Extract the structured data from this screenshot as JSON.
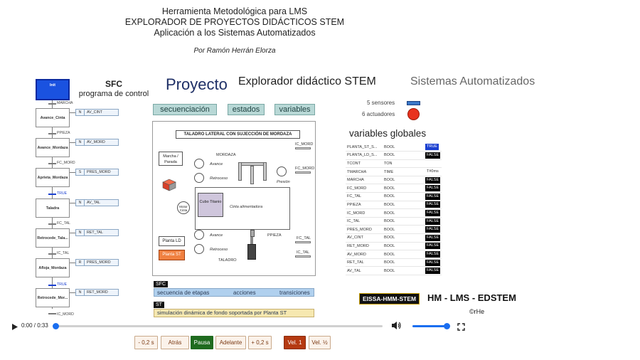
{
  "header": {
    "line1": "Herramienta Metodológica para LMS",
    "line2": "EXPLORADOR DE PROYECTOS DIDÁCTICOS STEM",
    "line3": "Aplicación a los Sistemas Automatizados",
    "author": "Por Ramón Herrán Elorza"
  },
  "sfc": {
    "title": "SFC",
    "subtitle": "programa de control",
    "steps": [
      {
        "name": "Init"
      },
      {
        "name": "Avance_Cinta",
        "qualifier": "N",
        "action": "AV_CINT"
      },
      {
        "name": "Avance_Mordaza",
        "qualifier": "N",
        "action": "AV_MORD"
      },
      {
        "name": "Aprieta_Mordaza",
        "qualifier": "S",
        "action": "PRES_MORD"
      },
      {
        "name": "Taladra",
        "qualifier": "N",
        "action": "AV_TAL"
      },
      {
        "name": "Retrocede_Tala...",
        "qualifier": "N",
        "action": "RET_TAL"
      },
      {
        "name": "Afloja_Mordaza",
        "qualifier": "R",
        "action": "PRES_MORD"
      },
      {
        "name": "Retrocede_Mor...",
        "qualifier": "N",
        "action": "RET_MORD"
      }
    ],
    "transitions": [
      "MARCHA",
      "PPIEZA",
      "FC_MORD",
      "TRUE",
      "FC_TAL",
      "IC_TAL",
      "TRUE",
      "IC_MORD"
    ]
  },
  "project": {
    "heading": "Proyecto",
    "subheading": "Explorador didáctico STEM",
    "category": "Sistemas Automatizados"
  },
  "tabs": {
    "secuenciacion": "secuenciación",
    "estados": "estados",
    "variables": "variables"
  },
  "legend": {
    "sensors": "5 sensores",
    "actuators": "6 actuadores",
    "sensor_color": "#3a78c8",
    "actuator_color": "#e8321e"
  },
  "diagram": {
    "title": "TALADRO LATERAL CON SUJECCIÓN DE MORDAZA",
    "mordaza": "MORDAZA",
    "ic_mord": "IC_MORD",
    "fc_mord": "FC_MORD",
    "marcha": "Marcha / Parada",
    "avance": "Avance",
    "retroceso": "Retroceso",
    "presion": "Presión",
    "motor": "Motor Cinta",
    "cubo": "Cubo Titanio",
    "cinta": "Cinta alimentadora",
    "ppieza": "PPIEZA",
    "avance2": "Avance",
    "retroceso2": "Retroceso",
    "fc_tal": "FC_TAL",
    "ic_tal": "IC_TAL",
    "taladro": "TALADRO",
    "planta_ld": "Planta LD",
    "planta_st": "Planta ST"
  },
  "globals": {
    "title": "variables globales",
    "rows": [
      [
        "PLANTA_ST_S...",
        "BOOL",
        "TRUE"
      ],
      [
        "PLANTA_LD_S...",
        "BOOL",
        "FALSE"
      ],
      [
        "TCONT",
        "TON",
        ""
      ],
      [
        "TMARCHA",
        "TIME",
        "T#0ms"
      ],
      [
        "MARCHA",
        "BOOL",
        "FALSE"
      ],
      [
        "FC_MORD",
        "BOOL",
        "FALSE"
      ],
      [
        "FC_TAL",
        "BOOL",
        "FALSE"
      ],
      [
        "PPIEZA",
        "BOOL",
        "FALSE"
      ],
      [
        "IC_MORD",
        "BOOL",
        "FALSE"
      ],
      [
        "IC_TAL",
        "BOOL",
        "FALSE"
      ],
      [
        "PRES_MORD",
        "BOOL",
        "FALSE"
      ],
      [
        "AV_CINT",
        "BOOL",
        "FALSE"
      ],
      [
        "RET_MORD",
        "BOOL",
        "FALSE"
      ],
      [
        "AV_MORD",
        "BOOL",
        "FALSE"
      ],
      [
        "RET_TAL",
        "BOOL",
        "FALSE"
      ],
      [
        "AV_TAL",
        "BOOL",
        "FALSE"
      ]
    ]
  },
  "bars": {
    "sfc_tag": "SFC",
    "sfc_items": [
      "secuencia de etapas",
      "acciones",
      "transiciones"
    ],
    "st_tag": "ST",
    "st_text": "simulación dinámica de fondo soportada por Planta ST"
  },
  "branding": {
    "badge": "EISSA-HMM-STEM",
    "title": "HM - LMS - EDSTEM",
    "copyright": "©rHe"
  },
  "player": {
    "time": "0:00 / 0:33",
    "progress": 0.0,
    "volume": 1.0,
    "buttons": [
      "- 0,2 s",
      "Atrás",
      "Pausa",
      "Adelante",
      "+ 0,2 s",
      "Vel. 1",
      "Vel. ½"
    ]
  }
}
